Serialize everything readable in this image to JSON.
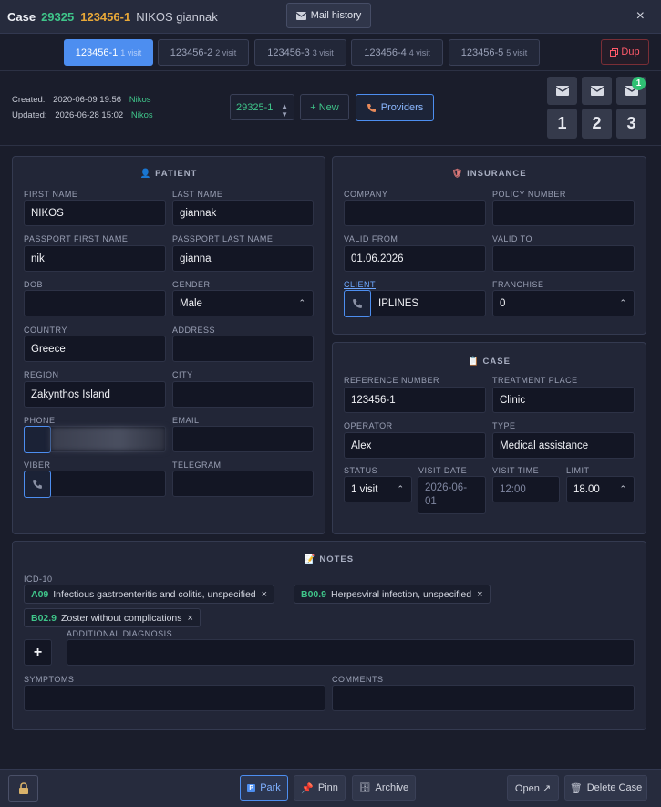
{
  "title": {
    "prefix": "Case",
    "case_number": "29325",
    "reference": "123456-1",
    "patient_name": "NIKOS giannak",
    "mail_history_label": "Mail history",
    "close_label": "×"
  },
  "tabs": [
    {
      "label": "123456-1",
      "sub": "1 visit",
      "active": true
    },
    {
      "label": "123456-2",
      "sub": "2 visit",
      "active": false
    },
    {
      "label": "123456-3",
      "sub": "3 visit",
      "active": false
    },
    {
      "label": "123456-4",
      "sub": "4 visit",
      "active": false
    },
    {
      "label": "123456-5",
      "sub": "5 visit",
      "active": false
    }
  ],
  "dup_label": "Dup",
  "meta": {
    "created_label": "Created:",
    "created_value": "2020-06-09 19:56",
    "created_user": "Nikos",
    "updated_label": "Updated:",
    "updated_value": "2026-06-28 15:02",
    "updated_user": "Nikos"
  },
  "toolbar": {
    "case_select": "29325-1",
    "new_label": "+ New",
    "providers_label": "Providers",
    "mail_badge": "1",
    "number_buttons": [
      "1",
      "2",
      "3"
    ]
  },
  "patient": {
    "heading": "PATIENT",
    "first_name_label": "FIRST NAME",
    "first_name": "NIKOS",
    "last_name_label": "LAST NAME",
    "last_name": "giannak",
    "passport_first_label": "PASSPORT FIRST NAME",
    "passport_first": "nik",
    "passport_last_label": "PASSPORT LAST NAME",
    "passport_last": "gianna",
    "dob_label": "DOB",
    "dob": "",
    "gender_label": "GENDER",
    "gender": "Male",
    "country_label": "COUNTRY",
    "country": "Greece",
    "address_label": "ADDRESS",
    "address": "",
    "region_label": "REGION",
    "region": "Zakynthos Island",
    "city_label": "CITY",
    "city": "",
    "phone_label": "PHONE",
    "phone": "",
    "email_label": "EMAIL",
    "email": "",
    "viber_label": "VIBER",
    "viber": "",
    "telegram_label": "TELEGRAM",
    "telegram": ""
  },
  "insurance": {
    "heading": "INSURANCE",
    "company_label": "COMPANY",
    "company": "",
    "policy_label": "POLICY NUMBER",
    "policy": "",
    "valid_from_label": "VALID FROM",
    "valid_from": "01.06.2026",
    "valid_to_label": "VALID TO",
    "valid_to": "",
    "client_label": "CLIENT",
    "client": "IPLINES",
    "franchise_label": "FRANCHISE",
    "franchise": "0"
  },
  "case": {
    "heading": "CASE",
    "reference_label": "REFERENCE NUMBER",
    "reference": "123456-1",
    "treatment_label": "TREATMENT PLACE",
    "treatment": "Clinic",
    "operator_label": "OPERATOR",
    "operator": "Alex",
    "type_label": "TYPE",
    "type": "Medical assistance",
    "status_label": "STATUS",
    "status": "1 visit",
    "visit_date_label": "VISIT DATE",
    "visit_date_line1": "2026-06-",
    "visit_date_line2": "01",
    "visit_time_label": "VISIT TIME",
    "visit_time": "12:00",
    "limit_label": "LIMIT",
    "limit": "18.00"
  },
  "notes": {
    "heading": "NOTES",
    "icd_label": "ICD-10",
    "diagnoses": [
      {
        "code": "A09",
        "text": "Infectious gastroenteritis and colitis, unspecified"
      },
      {
        "code": "B00.9",
        "text": "Herpesviral infection, unspecified"
      },
      {
        "code": "B02.9",
        "text": "Zoster without complications"
      }
    ],
    "additional_label": "ADDITIONAL DIAGNOSIS",
    "additional": "",
    "add_button": "+",
    "symptoms_label": "SYMPTOMS",
    "symptoms": "",
    "comments_label": "COMMENTS",
    "comments": ""
  },
  "footer": {
    "park_label": "Park",
    "pinn_label": "Pinn",
    "archive_label": "Archive",
    "open_label": "Open ↗",
    "delete_label": "Delete Case"
  },
  "colors": {
    "accent": "#4d8ef0",
    "green": "#3fc58a",
    "orange": "#e8a838",
    "danger": "#ff5a6a",
    "background": "#1a1d2b",
    "panel": "#222637"
  }
}
